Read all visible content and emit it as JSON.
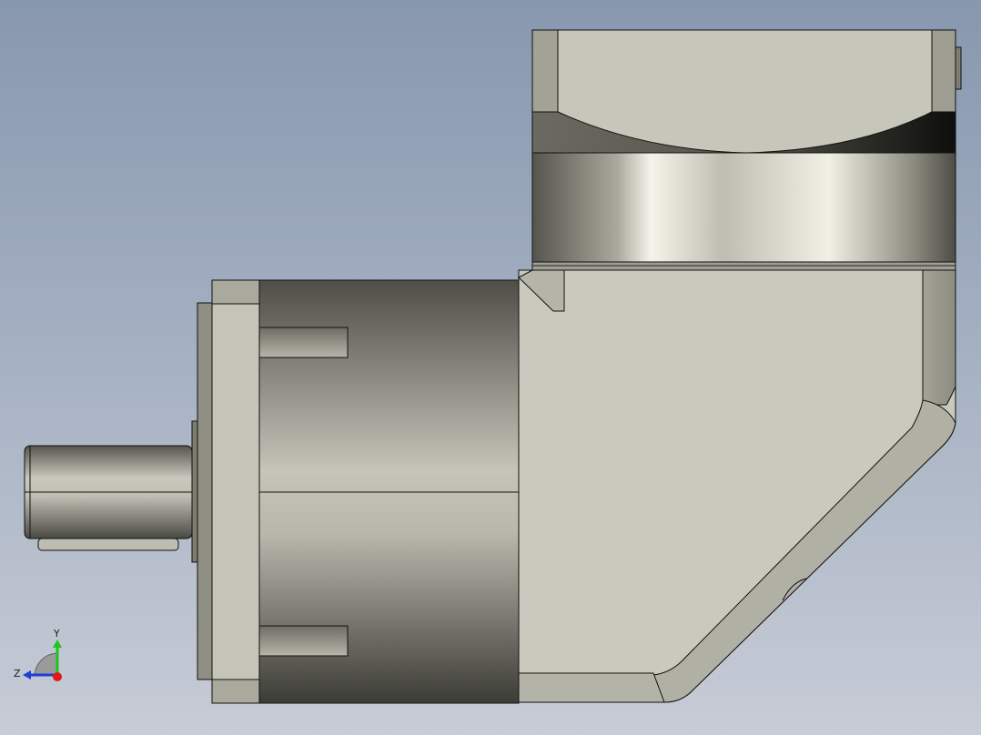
{
  "viewport": {
    "background_top": "#8797ae",
    "background_bottom": "#c7ccd6"
  },
  "model": {
    "description_icon": "right-angle-gearbox-model",
    "steel_color": "#c9c9bd",
    "dark_steel_color": "#4a4a42",
    "edge_color": "#111111"
  },
  "triad": {
    "x_label": "",
    "y_label": "Y",
    "z_label": "Z",
    "y_axis_color": "#1fc41f",
    "z_axis_color": "#1d3fd6",
    "origin_color": "#e01818"
  }
}
